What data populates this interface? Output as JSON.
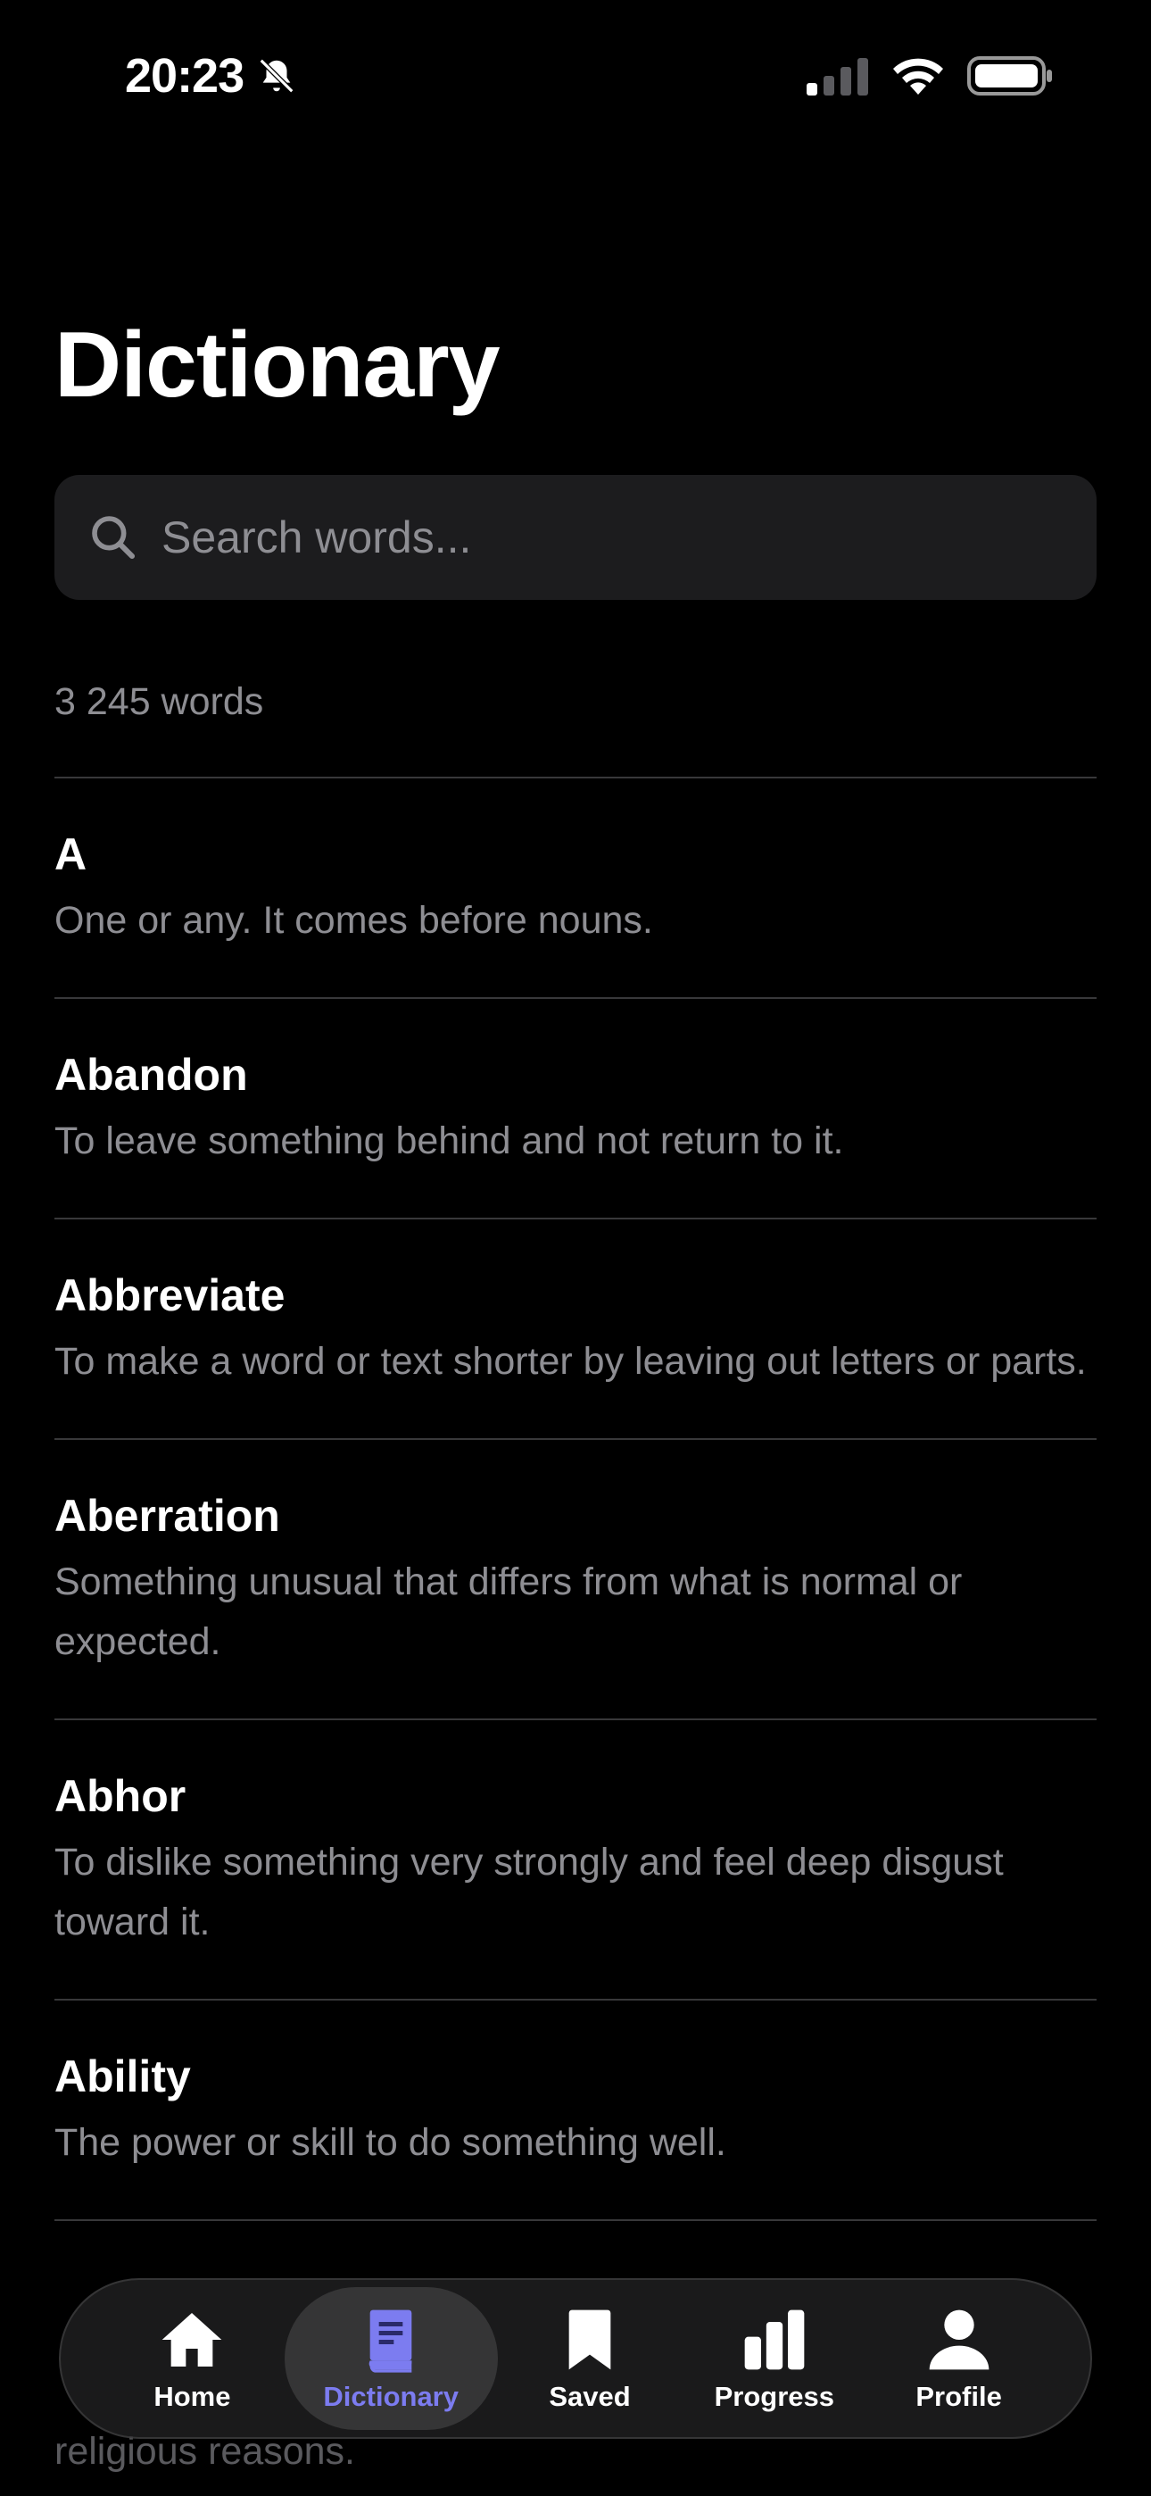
{
  "status": {
    "time": "20:23"
  },
  "header": {
    "title": "Dictionary"
  },
  "search": {
    "placeholder": "Search words..."
  },
  "word_count": "3 245 words",
  "entries": [
    {
      "word": "A",
      "definition": "One or any. It comes before nouns."
    },
    {
      "word": "Abandon",
      "definition": "To leave something behind and not return to it."
    },
    {
      "word": "Abbreviate",
      "definition": "To make a word or text shorter by leaving out letters or parts."
    },
    {
      "word": "Aberration",
      "definition": "Something unusual that differs from what is normal or expected."
    },
    {
      "word": "Abhor",
      "definition": "To dislike something very strongly and feel deep disgust toward it."
    },
    {
      "word": "Ability",
      "definition": "The power or skill to do something well."
    }
  ],
  "partial_entry": {
    "text": "religious reasons."
  },
  "tabbar": {
    "items": [
      {
        "label": "Home",
        "icon": "house-icon"
      },
      {
        "label": "Dictionary",
        "icon": "book-icon",
        "active": true
      },
      {
        "label": "Saved",
        "icon": "bookmark-icon"
      },
      {
        "label": "Progress",
        "icon": "bar-chart-icon"
      },
      {
        "label": "Profile",
        "icon": "person-icon"
      }
    ]
  },
  "colors": {
    "accent": "#7c7cf0",
    "background": "#000000",
    "muted": "#8e8e93"
  }
}
